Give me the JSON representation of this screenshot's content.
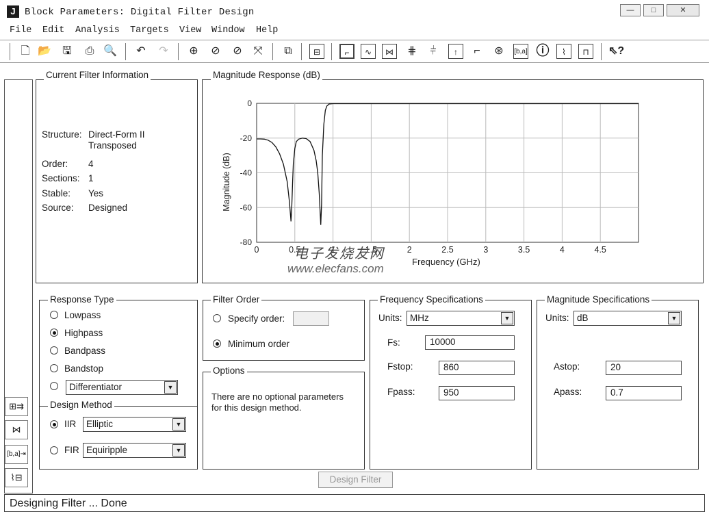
{
  "window": {
    "title": "Block Parameters: Digital Filter Design",
    "minimize_glyph": "—",
    "maximize_glyph": "□",
    "close_glyph": "✕"
  },
  "menu": [
    "File",
    "Edit",
    "Analysis",
    "Targets",
    "View",
    "Window",
    "Help"
  ],
  "toolbar_icons": [
    "new-icon",
    "open-icon",
    "save-icon",
    "print-icon",
    "print-preview-icon",
    "undo-icon",
    "redo-icon",
    "zoom-in-icon",
    "zoom-x-icon",
    "zoom-y-icon",
    "full-view-icon",
    "new-figure-icon",
    "filter-specs-icon",
    "magnitude-response-icon",
    "phase-response-icon",
    "mag-phase-icon",
    "group-delay-icon",
    "phase-delay-icon",
    "impulse-response-icon",
    "step-response-icon",
    "pole-zero-icon",
    "filter-coefficients-icon",
    "filter-info-icon",
    "magnitude-estimate-icon",
    "roundoff-noise-icon",
    "whats-this-icon"
  ],
  "current_filter": {
    "title": "Current Filter Information",
    "structure_label": "Structure:",
    "structure_value_1": "Direct-Form II",
    "structure_value_2": "Transposed",
    "order_label": "Order:",
    "order_value": "4",
    "sections_label": "Sections:",
    "sections_value": "1",
    "stable_label": "Stable:",
    "stable_value": "Yes",
    "source_label": "Source:",
    "source_value": "Designed"
  },
  "magnitude_panel": {
    "title": "Magnitude Response (dB)"
  },
  "chart_data": {
    "type": "line",
    "title": "",
    "xlabel": "Frequency (GHz)",
    "ylabel": "Magnitude (dB)",
    "xlim": [
      0,
      5
    ],
    "ylim": [
      -80,
      0
    ],
    "xticks": [
      0,
      0.5,
      1,
      1.5,
      2,
      2.5,
      3,
      3.5,
      4,
      4.5
    ],
    "xtick_labels": [
      "0",
      "0.5",
      "1",
      "1.5",
      "2",
      "2.5",
      "3",
      "3.5",
      "4",
      "4.5"
    ],
    "yticks": [
      0,
      -20,
      -40,
      -60,
      -80
    ],
    "ytick_labels": [
      "0",
      "-20",
      "-40",
      "-60",
      "-80"
    ],
    "grid": true,
    "series": [
      {
        "x": [
          0,
          0.05,
          0.1,
          0.15,
          0.2,
          0.25,
          0.3,
          0.35,
          0.4,
          0.43,
          0.45,
          0.46,
          0.47,
          0.48,
          0.5,
          0.52,
          0.55,
          0.6,
          0.65,
          0.7,
          0.75,
          0.78,
          0.8,
          0.82,
          0.84,
          0.85,
          0.86,
          0.88,
          0.9,
          0.92,
          0.95,
          1.0,
          1.5,
          2,
          2.5,
          3,
          3.5,
          4,
          4.5,
          5
        ],
        "y": [
          -20.5,
          -20.5,
          -20.6,
          -21.2,
          -22.5,
          -25,
          -29,
          -35,
          -45,
          -57,
          -68,
          -60,
          -46,
          -35,
          -26,
          -22,
          -20.6,
          -20,
          -20.3,
          -22,
          -27,
          -33,
          -40,
          -52,
          -70,
          -58,
          -30,
          -12,
          -4,
          -1.5,
          -0.4,
          -0.2,
          -0.2,
          -0.2,
          -0.2,
          -0.2,
          -0.2,
          -0.2,
          -0.2,
          -0.2
        ]
      }
    ]
  },
  "response_type": {
    "title": "Response Type",
    "options": [
      "Lowpass",
      "Highpass",
      "Bandpass",
      "Bandstop"
    ],
    "selected": "Highpass",
    "other_select": "Differentiator"
  },
  "design_method": {
    "title": "Design Method",
    "iir_label": "IIR",
    "iir_value": "Elliptic",
    "fir_label": "FIR",
    "fir_value": "Equiripple",
    "selected": "IIR"
  },
  "filter_order": {
    "title": "Filter Order",
    "specify_label": "Specify order:",
    "specify_value": "",
    "minimum_label": "Minimum order",
    "selected": "Minimum order"
  },
  "options": {
    "title": "Options",
    "text_1": "There are no optional parameters",
    "text_2": "for this design method."
  },
  "frequency_specs": {
    "title": "Frequency Specifications",
    "units_label": "Units:",
    "units_value": "MHz",
    "fs_label": "Fs:",
    "fs_value": "10000",
    "fstop_label": "Fstop:",
    "fstop_value": "860",
    "fpass_label": "Fpass:",
    "fpass_value": "950"
  },
  "magnitude_specs": {
    "title": "Magnitude Specifications",
    "units_label": "Units:",
    "units_value": "dB",
    "astop_label": "Astop:",
    "astop_value": "20",
    "apass_label": "Apass:",
    "apass_value": "0.7"
  },
  "design_button": "Design Filter",
  "status": "Designing Filter ... Done",
  "watermark": {
    "cn": "电子发烧友网",
    "url": "www.elecfans.com"
  },
  "side_icons": [
    "realize-model-icon",
    "transform-filter-icon",
    "import-filter-icon",
    "filter-design-icon"
  ]
}
